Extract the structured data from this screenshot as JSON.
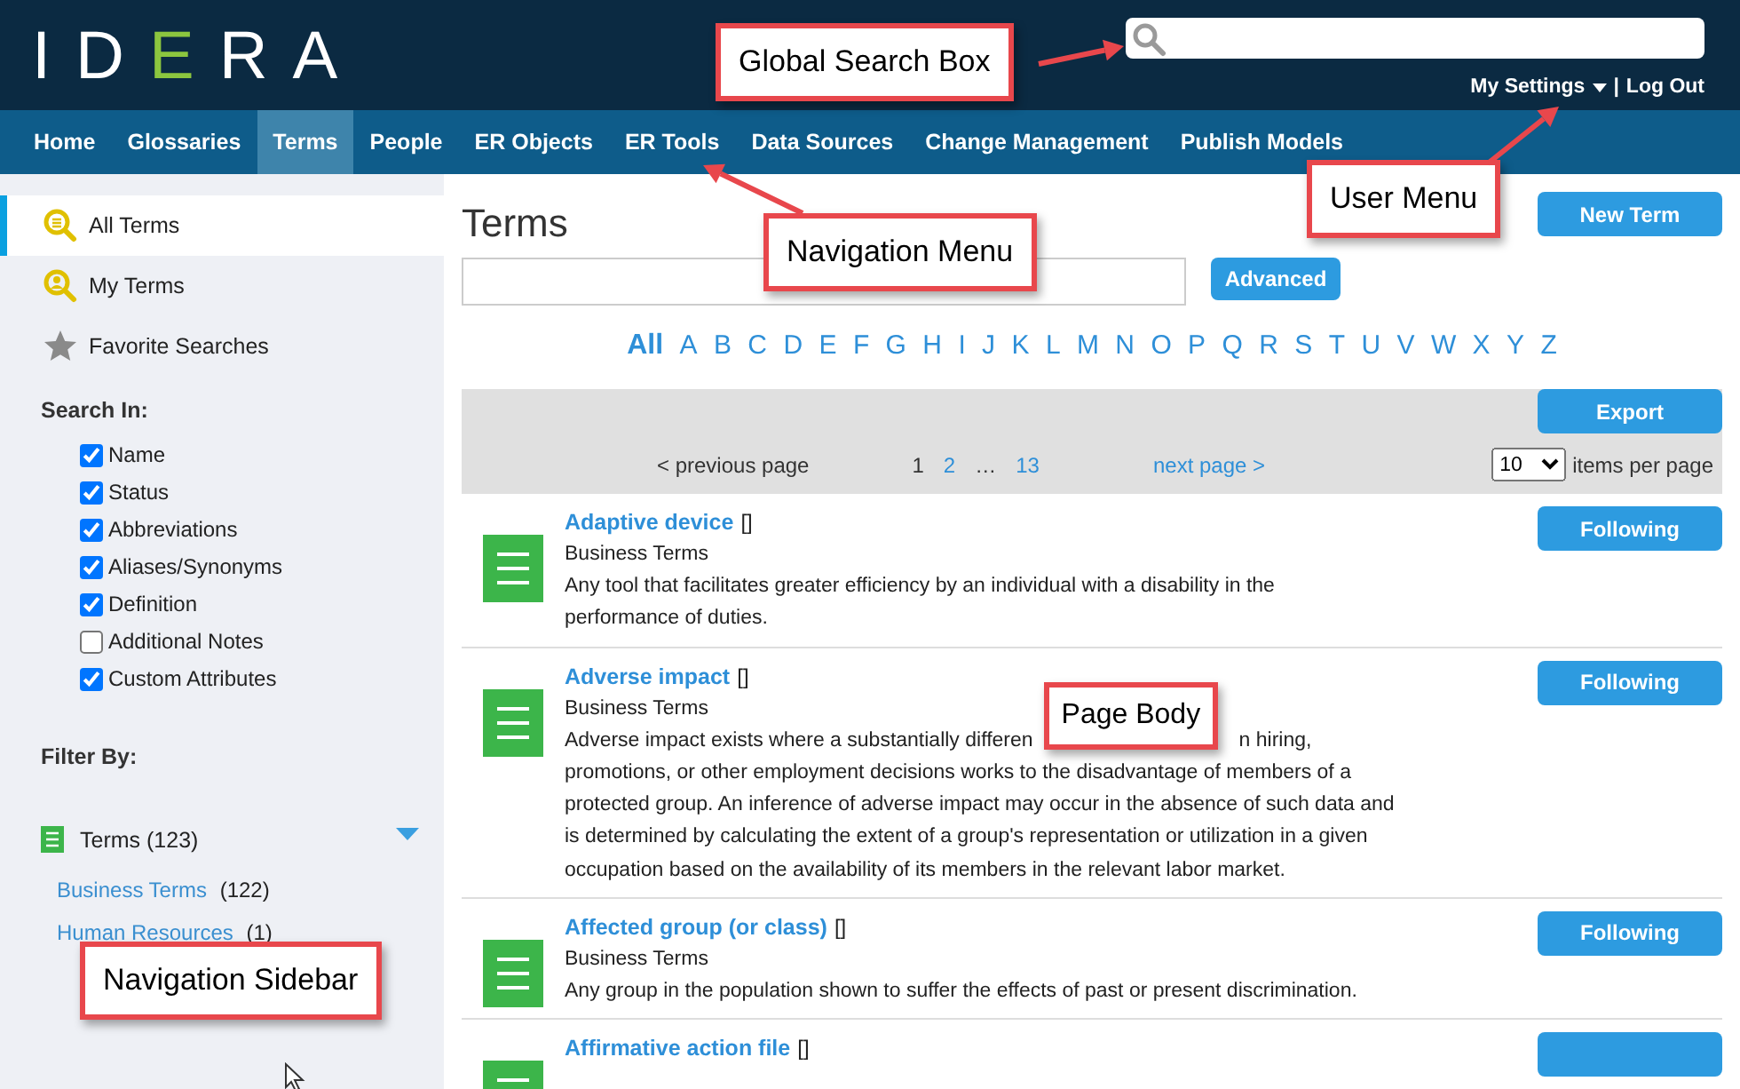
{
  "header": {
    "logo": [
      {
        "text": "ID",
        "accent": false
      },
      {
        "text": "E",
        "accent": true
      },
      {
        "text": "RA",
        "accent": false
      }
    ],
    "user_menu": {
      "settings": "My Settings",
      "separator": "|",
      "logout": "Log Out"
    }
  },
  "nav": [
    {
      "label": "Home",
      "selected": false
    },
    {
      "label": "Glossaries",
      "selected": false
    },
    {
      "label": "Terms",
      "selected": true
    },
    {
      "label": "People",
      "selected": false
    },
    {
      "label": "ER Objects",
      "selected": false
    },
    {
      "label": "ER Tools",
      "selected": false
    },
    {
      "label": "Data Sources",
      "selected": false
    },
    {
      "label": "Change Management",
      "selected": false
    },
    {
      "label": "Publish Models",
      "selected": false
    }
  ],
  "sidebar": {
    "items": [
      {
        "label": "All Terms",
        "kind": "list-search",
        "selected": true
      },
      {
        "label": "My Terms",
        "kind": "person-search",
        "selected": false
      },
      {
        "label": "Favorite Searches",
        "kind": "star",
        "selected": false
      }
    ],
    "search_in": {
      "label": "Search In:",
      "options": [
        {
          "label": "Name",
          "checked": true
        },
        {
          "label": "Status",
          "checked": true
        },
        {
          "label": "Abbreviations",
          "checked": true
        },
        {
          "label": "Aliases/Synonyms",
          "checked": true
        },
        {
          "label": "Definition",
          "checked": true
        },
        {
          "label": "Additional Notes",
          "checked": false
        },
        {
          "label": "Custom Attributes",
          "checked": true
        }
      ]
    },
    "filter": {
      "label": "Filter By:",
      "group": {
        "label": "Terms",
        "count": "(123)",
        "expanded": true,
        "children": [
          {
            "label": "Business Terms",
            "count": "(122)"
          },
          {
            "label": "Human Resources",
            "count": "(1)"
          }
        ]
      }
    }
  },
  "main": {
    "title": "Terms",
    "new_button": "New Term",
    "advanced_button": "Advanced",
    "letters": [
      {
        "label": "All",
        "selected": true
      },
      {
        "label": "A",
        "selected": false
      },
      {
        "label": "B",
        "selected": false
      },
      {
        "label": "C",
        "selected": false
      },
      {
        "label": "D",
        "selected": false
      },
      {
        "label": "E",
        "selected": false
      },
      {
        "label": "F",
        "selected": false
      },
      {
        "label": "G",
        "selected": false
      },
      {
        "label": "H",
        "selected": false
      },
      {
        "label": "I",
        "selected": false
      },
      {
        "label": "J",
        "selected": false
      },
      {
        "label": "K",
        "selected": false
      },
      {
        "label": "L",
        "selected": false
      },
      {
        "label": "M",
        "selected": false
      },
      {
        "label": "N",
        "selected": false
      },
      {
        "label": "O",
        "selected": false
      },
      {
        "label": "P",
        "selected": false
      },
      {
        "label": "Q",
        "selected": false
      },
      {
        "label": "R",
        "selected": false
      },
      {
        "label": "S",
        "selected": false
      },
      {
        "label": "T",
        "selected": false
      },
      {
        "label": "U",
        "selected": false
      },
      {
        "label": "V",
        "selected": false
      },
      {
        "label": "W",
        "selected": false
      },
      {
        "label": "X",
        "selected": false
      },
      {
        "label": "Y",
        "selected": false
      },
      {
        "label": "Z",
        "selected": false
      }
    ],
    "export_button": "Export",
    "pagination": {
      "previous": "< previous page",
      "pages": [
        {
          "label": "1",
          "kind": "page",
          "selected": true
        },
        {
          "label": "2",
          "kind": "page",
          "selected": false
        },
        {
          "label": "…",
          "kind": "gap"
        },
        {
          "label": "13",
          "kind": "page",
          "selected": false
        }
      ],
      "next": "next page >",
      "per_page": {
        "value": "10",
        "label": "items per page"
      }
    },
    "terms": [
      {
        "title": "Adaptive device",
        "brackets": "[]",
        "glossary": "Business Terms",
        "button": "Following",
        "lines": [
          "Any tool that facilitates greater efficiency by an individual with a disability in the",
          "performance of duties."
        ]
      },
      {
        "title": "Adverse impact",
        "brackets": "[]",
        "glossary": "Business Terms",
        "button": "Following",
        "lines": [
          [
            "Adverse impact exists where a substantially differen",
            "n hiring,"
          ],
          "promotions, or other employment decisions works to the disadvantage of members of a",
          "protected group. An inference of adverse impact may occur in the absence of such data and",
          "is determined by calculating the extent of a group's representation or utilization in a given",
          "occupation based on the availability of its members in the relevant labor market."
        ]
      },
      {
        "title": "Affected group (or class)",
        "brackets": "[]",
        "glossary": "Business Terms",
        "button": "Following",
        "lines": [
          "Any group in the population shown to suffer the effects of past or present discrimination."
        ]
      },
      {
        "title": "Affirmative action file",
        "brackets": "[]"
      }
    ]
  },
  "annotations": {
    "global_search": "Global Search Box",
    "navigation_menu": "Navigation Menu",
    "user_menu": "User Menu",
    "page_body": "Page Body",
    "navigation_sidebar": "Navigation Sidebar"
  }
}
